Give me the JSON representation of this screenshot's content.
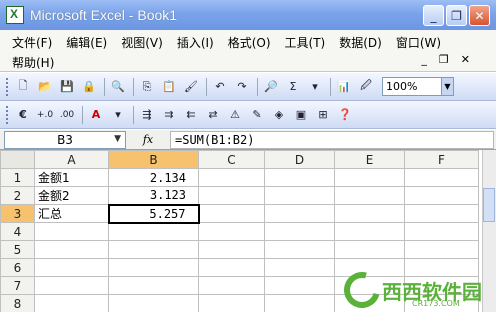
{
  "window": {
    "title": "Microsoft Excel - Book1"
  },
  "menu": {
    "items": [
      "文件(F)",
      "编辑(E)",
      "视图(V)",
      "插入(I)",
      "格式(O)",
      "工具(T)",
      "数据(D)",
      "窗口(W)"
    ],
    "help": "帮助(H)"
  },
  "toolbar": {
    "zoom": "100%",
    "sum_symbol": "Σ"
  },
  "formula_bar": {
    "name_box": "B3",
    "fx_label": "fx",
    "formula": "=SUM(B1:B2)"
  },
  "sheet": {
    "columns": [
      "A",
      "B",
      "C",
      "D",
      "E",
      "F"
    ],
    "rows": [
      {
        "n": "1",
        "a": "金额1",
        "b": "2.134"
      },
      {
        "n": "2",
        "a": "金额2",
        "b": "3.123"
      },
      {
        "n": "3",
        "a": "汇总",
        "b": "5.257"
      },
      {
        "n": "4",
        "a": "",
        "b": ""
      },
      {
        "n": "5",
        "a": "",
        "b": ""
      },
      {
        "n": "6",
        "a": "",
        "b": ""
      },
      {
        "n": "7",
        "a": "",
        "b": ""
      },
      {
        "n": "8",
        "a": "",
        "b": ""
      }
    ],
    "active_cell": "B3",
    "colors": {
      "selected_header": "#f6c26e",
      "grid": "#c0c0c0"
    }
  },
  "watermark": {
    "brand": "西西软件园",
    "site": "CR173.COM"
  }
}
